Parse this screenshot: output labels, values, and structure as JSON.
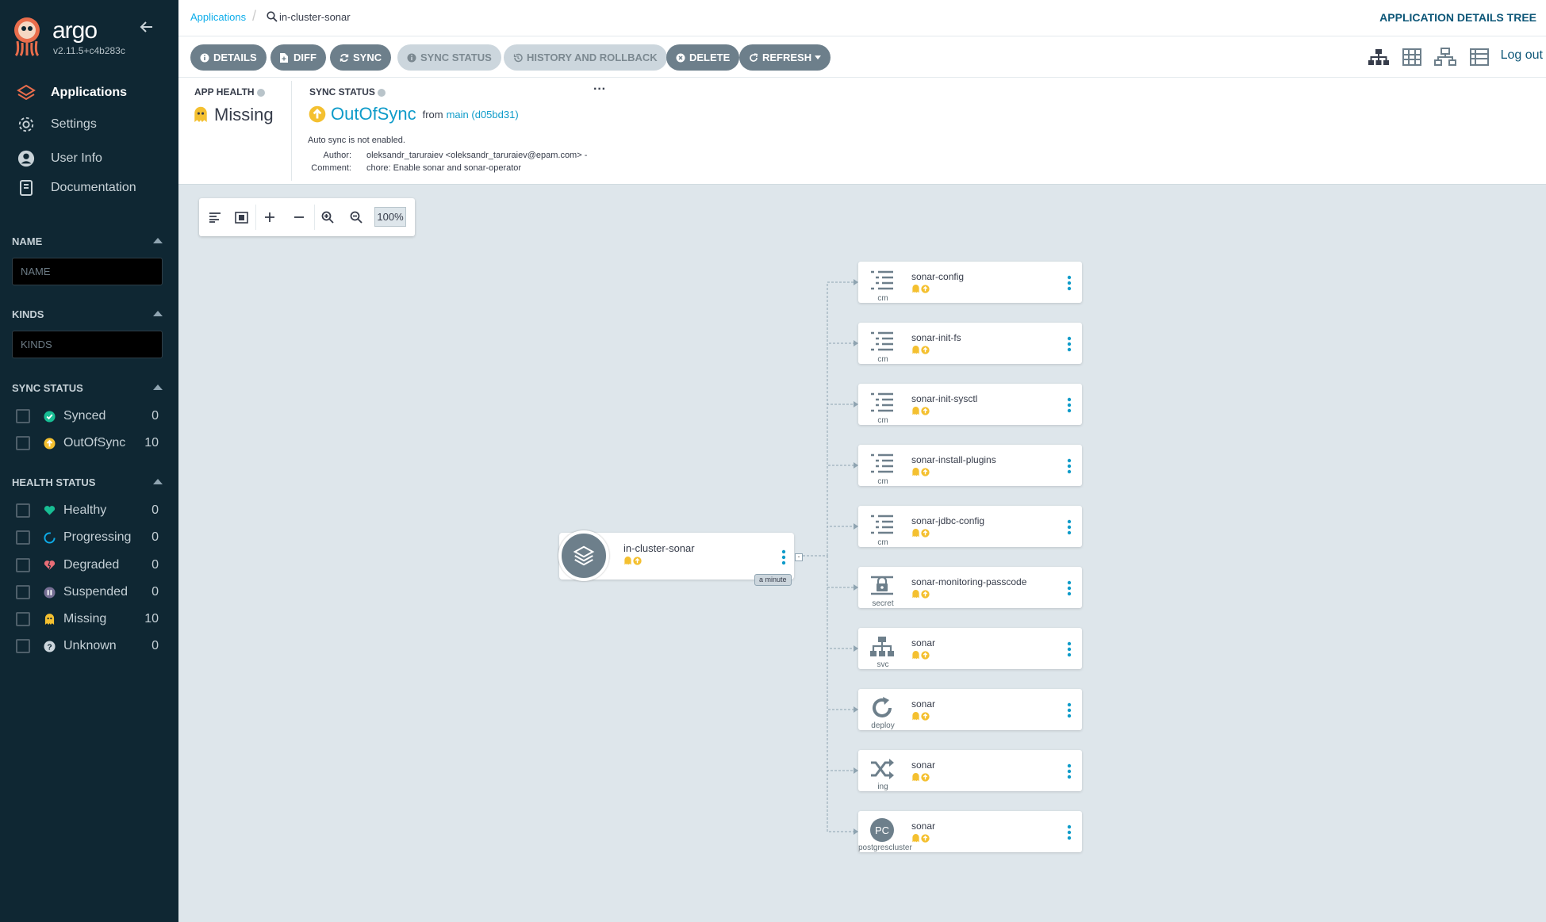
{
  "sidebar": {
    "brand": "argo",
    "version": "v2.11.5+c4b283c",
    "nav": [
      {
        "label": "Applications",
        "icon": "layers-icon"
      },
      {
        "label": "Settings",
        "icon": "gear-icon"
      },
      {
        "label": "User Info",
        "icon": "user-icon"
      },
      {
        "label": "Documentation",
        "icon": "book-icon"
      }
    ],
    "name_filter": {
      "title": "NAME",
      "placeholder": "NAME"
    },
    "kinds_filter": {
      "title": "KINDS",
      "placeholder": "KINDS"
    },
    "sync_status": {
      "title": "SYNC STATUS",
      "items": [
        {
          "label": "Synced",
          "count": "0",
          "icon": "check-circle-icon"
        },
        {
          "label": "OutOfSync",
          "count": "10",
          "icon": "arrow-up-circle-icon"
        }
      ]
    },
    "health_status": {
      "title": "HEALTH STATUS",
      "items": [
        {
          "label": "Healthy",
          "count": "0",
          "icon": "heart-icon"
        },
        {
          "label": "Progressing",
          "count": "0",
          "icon": "spinner-icon"
        },
        {
          "label": "Degraded",
          "count": "0",
          "icon": "broken-heart-icon"
        },
        {
          "label": "Suspended",
          "count": "0",
          "icon": "pause-icon"
        },
        {
          "label": "Missing",
          "count": "10",
          "icon": "ghost-icon"
        },
        {
          "label": "Unknown",
          "count": "0",
          "icon": "question-icon"
        }
      ]
    }
  },
  "header": {
    "breadcrumb_root": "Applications",
    "breadcrumb_current": "in-cluster-sonar",
    "page_title": "APPLICATION DETAILS TREE",
    "logout": "Log out"
  },
  "toolbar": {
    "details": "DETAILS",
    "diff": "DIFF",
    "sync": "SYNC",
    "sync_status": "SYNC STATUS",
    "history": "HISTORY AND ROLLBACK",
    "delete": "DELETE",
    "refresh": "REFRESH"
  },
  "summary": {
    "app_health_label": "APP HEALTH",
    "app_health_value": "Missing",
    "sync_status_label": "SYNC STATUS",
    "sync_status_value": "OutOfSync",
    "from_label": "from",
    "revision": "main (d05bd31)",
    "auto_sync": "Auto sync is not enabled.",
    "author_label": "Author:",
    "author": "oleksandr_taruraiev <oleksandr_taruraiev@epam.com> -",
    "comment_label": "Comment:",
    "comment": "chore: Enable sonar and sonar-operator",
    "menu": "···"
  },
  "canvas": {
    "zoom": "100%",
    "app_node": {
      "name": "in-cluster-sonar",
      "age": "a minute"
    },
    "resources": [
      {
        "name": "sonar-config",
        "kind": "cm",
        "icon": "list-icon"
      },
      {
        "name": "sonar-init-fs",
        "kind": "cm",
        "icon": "list-icon"
      },
      {
        "name": "sonar-init-sysctl",
        "kind": "cm",
        "icon": "list-icon"
      },
      {
        "name": "sonar-install-plugins",
        "kind": "cm",
        "icon": "list-icon"
      },
      {
        "name": "sonar-jdbc-config",
        "kind": "cm",
        "icon": "list-icon"
      },
      {
        "name": "sonar-monitoring-passcode",
        "kind": "secret",
        "icon": "secret-icon"
      },
      {
        "name": "sonar",
        "kind": "svc",
        "icon": "network-icon"
      },
      {
        "name": "sonar",
        "kind": "deploy",
        "icon": "refresh-icon"
      },
      {
        "name": "sonar",
        "kind": "ing",
        "icon": "shuffle-icon"
      },
      {
        "name": "sonar",
        "kind": "postgrescluster",
        "icon": "pc-badge-icon",
        "badge": "PC"
      }
    ]
  },
  "colors": {
    "sidebar_bg": "#0f2733",
    "accent": "#0e9bc9",
    "missing_yellow": "#f4c030",
    "outofsync_yellow": "#f4c030",
    "synced_green": "#18be94",
    "degraded_red": "#e96d76",
    "suspended_purple": "#766f94",
    "button_gray": "#6d7f8b"
  }
}
